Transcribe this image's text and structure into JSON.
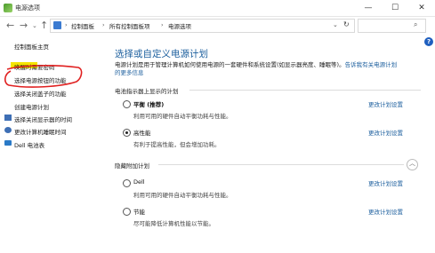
{
  "window": {
    "title": "电源选项",
    "minimize": "—",
    "maximize": "☐",
    "close": "✕"
  },
  "nav": {
    "back": "←",
    "forward": "→",
    "up": "↑",
    "dropdown": "⌄",
    "breadcrumb": [
      "控制面板",
      "所有控制面板项",
      "电源选项"
    ],
    "separator": "›",
    "refresh": "↻",
    "search_icon": "⌕"
  },
  "help": "?",
  "sidebar": {
    "home": "控制面板主页",
    "items": [
      "唤醒时需要密码",
      "选择电源按钮的功能",
      "选择关闭盖子的功能",
      "创建电源计划",
      "选择关闭显示器的时间",
      "更改计算机睡眠时间"
    ],
    "battery": "Dell 电池表"
  },
  "main": {
    "title": "选择或自定义电源计划",
    "description_line1": "电源计划是用于管理计算机如何使用电源的一套硬件和系统设置(如显示器亮度、睡眠等)。",
    "description_link": "告诉我有关电源计划",
    "description_line2": "的更多信息",
    "section_battery": "电池指示器上显示的计划",
    "section_hidden": "隐藏附加计划",
    "plans": [
      {
        "name": "平衡 (推荐)",
        "desc": "利用可用的硬件自动平衡功耗与性能。",
        "link": "更改计划设置",
        "checked": false
      },
      {
        "name": "高性能",
        "desc": "有利于提高性能，但会增加功耗。",
        "link": "更改计划设置",
        "checked": true
      },
      {
        "name": "Dell",
        "desc": "利用可用的硬件自动平衡功耗与性能。",
        "link": "更改计划设置",
        "checked": false
      },
      {
        "name": "节能",
        "desc": "尽可能降低计算机性能以节能。",
        "link": "更改计划设置",
        "checked": false
      }
    ],
    "collapse": "︿"
  },
  "colors": {
    "accent": "#1b5e9d",
    "highlight": "#f5e400",
    "annotation": "#e02020"
  }
}
